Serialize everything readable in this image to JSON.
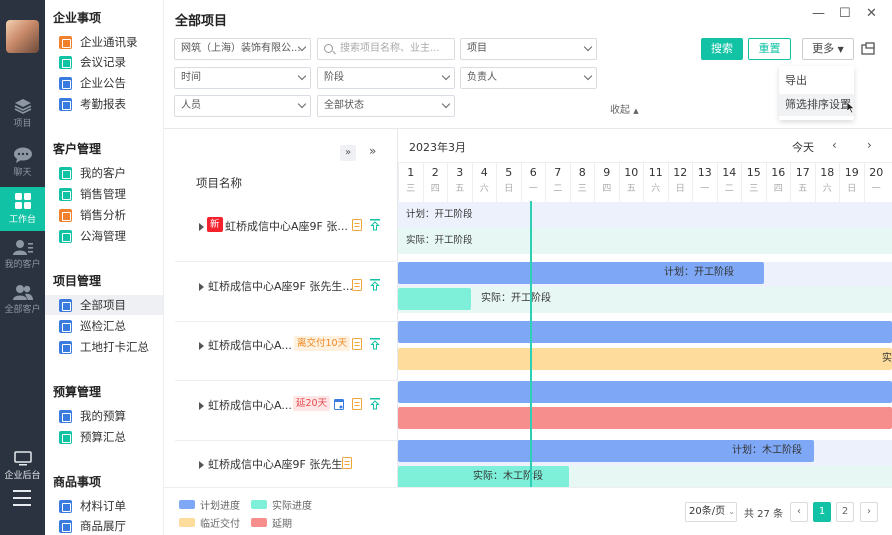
{
  "colors": {
    "brand": "#12c2a5",
    "plan": "#7ea8f5",
    "actual": "#7ef0d9",
    "near_due": "#fddc9c",
    "overdue": "#f78e8e",
    "rail": "#2b3340"
  },
  "rail": {
    "items": [
      {
        "label": "项目",
        "icon": "layers-icon"
      },
      {
        "label": "聊天",
        "icon": "chat-icon"
      },
      {
        "label": "工作台",
        "icon": "grid-icon"
      },
      {
        "label": "我的客户",
        "icon": "user-list-icon"
      },
      {
        "label": "全部客户",
        "icon": "users-icon"
      }
    ],
    "bottom_label": "企业后台"
  },
  "sidebar": {
    "groups": [
      {
        "title": "企业事项",
        "items": [
          "企业通讯录",
          "会议记录",
          "企业公告",
          "考勤报表"
        ]
      },
      {
        "title": "客户管理",
        "items": [
          "我的客户",
          "销售管理",
          "销售分析",
          "公海管理"
        ]
      },
      {
        "title": "项目管理",
        "items": [
          "全部项目",
          "巡检汇总",
          "工地打卡汇总"
        ]
      },
      {
        "title": "预算管理",
        "items": [
          "我的预算",
          "预算汇总"
        ]
      },
      {
        "title": "商品事项",
        "items": [
          "材料订单",
          "商品展厅"
        ]
      }
    ]
  },
  "header": {
    "title": "全部项目",
    "company_select": "网筑（上海）装饰有限公...",
    "search_placeholder": "搜索项目名称、业主...",
    "project_select": "项目",
    "time_select": "时间",
    "stage_select": "阶段",
    "owner_select": "负责人",
    "staff_select": "人员",
    "status_select": "全部状态",
    "collapse": "收起",
    "search_btn": "搜索",
    "reset_btn": "重置",
    "more_btn": "更多",
    "more_menu": [
      "导出",
      "筛选排序设置"
    ]
  },
  "gantt": {
    "column_header": "项目名称",
    "month": "2023年3月",
    "today": "今天",
    "days": [
      {
        "d": "1",
        "w": "三"
      },
      {
        "d": "2",
        "w": "四"
      },
      {
        "d": "3",
        "w": "五"
      },
      {
        "d": "4",
        "w": "六"
      },
      {
        "d": "5",
        "w": "日"
      },
      {
        "d": "6",
        "w": "一"
      },
      {
        "d": "7",
        "w": "二"
      },
      {
        "d": "8",
        "w": "三"
      },
      {
        "d": "9",
        "w": "四"
      },
      {
        "d": "10",
        "w": "五"
      },
      {
        "d": "11",
        "w": "六"
      },
      {
        "d": "12",
        "w": "日"
      },
      {
        "d": "13",
        "w": "一"
      },
      {
        "d": "14",
        "w": "二"
      },
      {
        "d": "15",
        "w": "三"
      },
      {
        "d": "16",
        "w": "四"
      },
      {
        "d": "17",
        "w": "五"
      },
      {
        "d": "18",
        "w": "六"
      },
      {
        "d": "19",
        "w": "日"
      },
      {
        "d": "20",
        "w": "一"
      }
    ],
    "rows": [
      {
        "name": "虹桥成信中心A座9F 张...",
        "tag": "新",
        "plan": "计划：开工阶段",
        "actual": "实际：开工阶段"
      },
      {
        "name": "虹桥成信中心A座9F 张先生...",
        "tag": "",
        "plan": "计划：开工阶段",
        "actual": "实际：开工阶段"
      },
      {
        "name": "虹桥成信中心A...",
        "tag": "离交付10天",
        "plan": "",
        "actual": "实"
      },
      {
        "name": "虹桥成信中心A...",
        "tag": "延20天",
        "plan": "",
        "actual": ""
      },
      {
        "name": "虹桥成信中心A座9F 张先生",
        "tag": "",
        "plan": "计划：木工阶段",
        "actual": "实际：木工阶段"
      }
    ]
  },
  "legend": [
    "计划进度",
    "实际进度",
    "临近交付",
    "延期"
  ],
  "pager": {
    "page_size": "20条/页",
    "total": "共 27 条",
    "pages": [
      "1",
      "2"
    ]
  }
}
